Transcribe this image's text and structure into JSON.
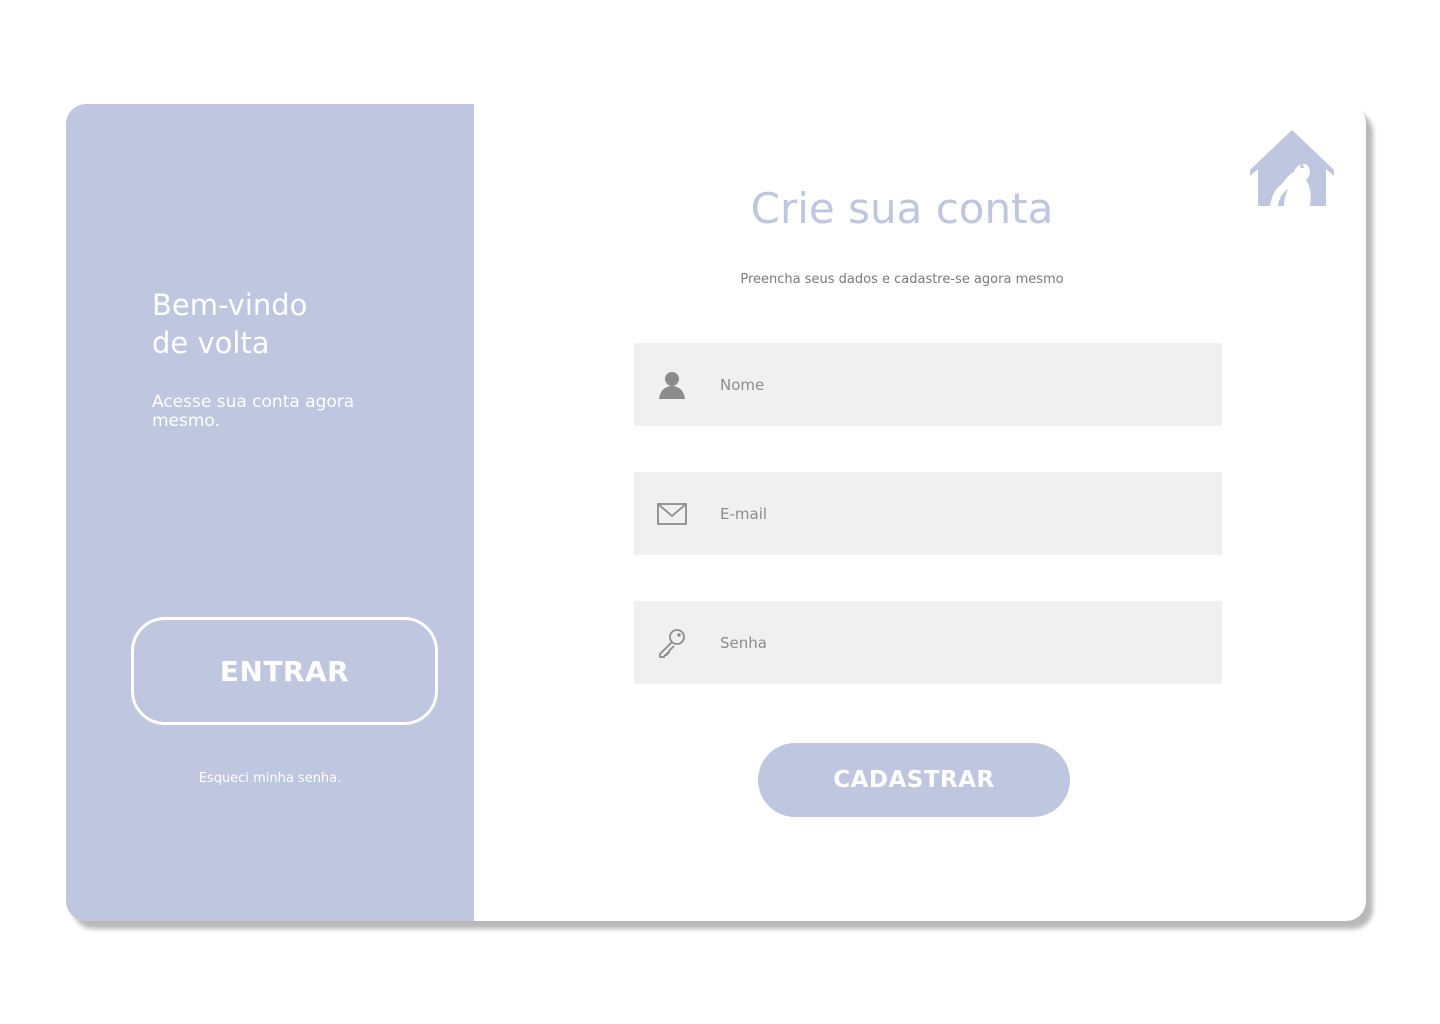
{
  "colors": {
    "accent": "#bec6e0",
    "field_background": "#f0f0f0",
    "placeholder_text": "#8c8c8c",
    "white": "#ffffff"
  },
  "welcome": {
    "title_line1": "Bem-vindo",
    "title_line2": "de volta",
    "subtitle": "Acesse sua conta agora mesmo.",
    "enter_label": "ENTRAR",
    "forgot_label": "Esqueci minha senha."
  },
  "logo": {
    "icon": "pet-house-icon"
  },
  "signup": {
    "title": "Crie sua conta",
    "subtitle": "Preencha seus dados e cadastre-se agora mesmo",
    "fields": [
      {
        "icon": "user-icon",
        "placeholder": "Nome",
        "value": ""
      },
      {
        "icon": "mail-icon",
        "placeholder": "E-mail",
        "value": ""
      },
      {
        "icon": "key-icon",
        "placeholder": "Senha",
        "value": ""
      }
    ],
    "submit_label": "CADASTRAR"
  }
}
